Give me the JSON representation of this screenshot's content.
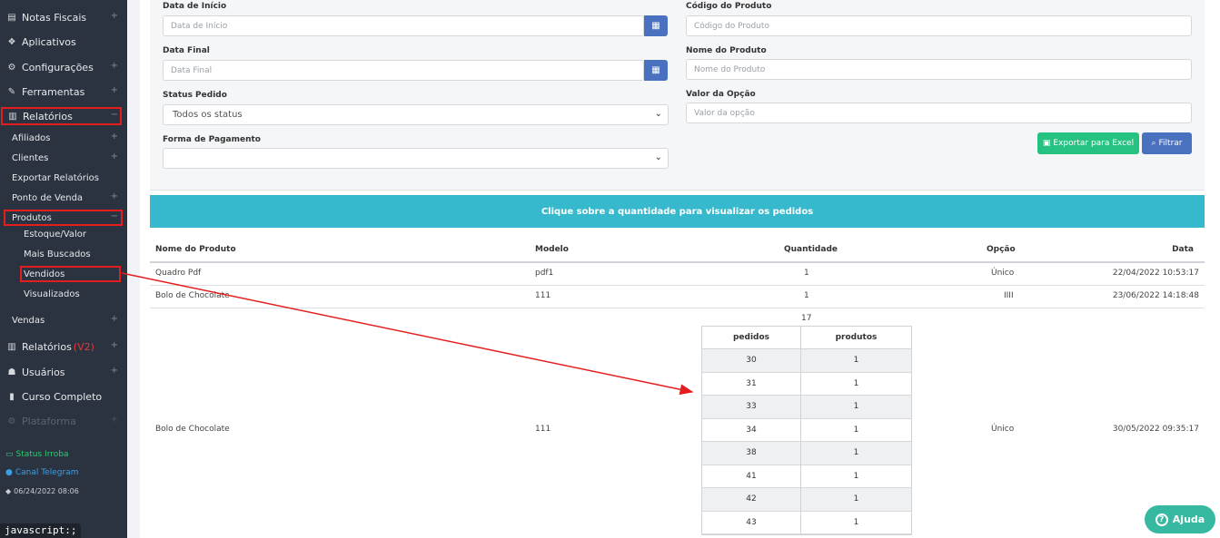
{
  "sidebar": {
    "items": [
      {
        "label": "Notas Fiscais",
        "icon": "receipt-icon",
        "glyph": "▤",
        "plus": "+"
      },
      {
        "label": "Aplicativos",
        "icon": "cubes-icon",
        "glyph": "❖",
        "plus": ""
      },
      {
        "label": "Configurações",
        "icon": "cogs-icon",
        "glyph": "⚙",
        "plus": "+"
      },
      {
        "label": "Ferramentas",
        "icon": "wrench-icon",
        "glyph": "✎",
        "plus": "+"
      },
      {
        "label": "Relatórios",
        "icon": "bar-chart-icon",
        "glyph": "▥",
        "plus": "−"
      }
    ],
    "sub": [
      {
        "label": "Afiliados",
        "plus": "+"
      },
      {
        "label": "Clientes",
        "plus": "+"
      },
      {
        "label": "Exportar Relatórios",
        "plus": ""
      },
      {
        "label": "Ponto de Venda",
        "plus": "+"
      },
      {
        "label": "Produtos",
        "plus": "−"
      }
    ],
    "subsub": [
      {
        "label": "Estoque/Valor"
      },
      {
        "label": "Mais Buscados"
      },
      {
        "label": "Vendidos"
      },
      {
        "label": "Visualizados"
      }
    ],
    "vendas": {
      "label": "Vendas",
      "plus": "+"
    },
    "items2": [
      {
        "label": "Relatórios",
        "suffix": "(V2)",
        "icon": "bar-chart-icon",
        "glyph": "▥",
        "plus": "+"
      },
      {
        "label": "Usuários",
        "icon": "users-icon",
        "glyph": "☗",
        "plus": "+"
      },
      {
        "label": "Curso Completo",
        "icon": "book-icon",
        "glyph": "▮",
        "plus": ""
      },
      {
        "label": "Plataforma",
        "icon": "cogs-icon",
        "glyph": "⚙",
        "plus": "+"
      }
    ],
    "footer": {
      "status": "Status Irroba",
      "telegram": "Canal Telegram",
      "timestamp": "06/24/2022 08:06"
    }
  },
  "statusbar": "javascript:;",
  "filters": {
    "start_date": {
      "label": "Data de Início",
      "placeholder": "Data de Início"
    },
    "end_date": {
      "label": "Data Final",
      "placeholder": "Data Final"
    },
    "status": {
      "label": "Status Pedido",
      "value": "Todos os status"
    },
    "payment": {
      "label": "Forma de Pagamento",
      "value": ""
    },
    "product_code": {
      "label": "Código do Produto",
      "placeholder": "Código do Produto"
    },
    "product_name": {
      "label": "Nome do Produto",
      "placeholder": "Nome do Produto"
    },
    "option_value": {
      "label": "Valor da Opção",
      "placeholder": "Valor da opção"
    },
    "export_label": "Exportar para Excel",
    "filter_label": "Filtrar"
  },
  "banner": "Clique sobre a quantidade para visualizar os pedidos",
  "table": {
    "headers": [
      "Nome do Produto",
      "Modelo",
      "Quantidade",
      "Opção",
      "Data"
    ],
    "rows": [
      {
        "name": "Quadro Pdf",
        "model": "pdf1",
        "qty": "1",
        "option": "Único",
        "date": "22/04/2022 10:53:17"
      },
      {
        "name": "Bolo de Chocolate",
        "model": "111",
        "qty": "1",
        "option": "IIII",
        "date": "23/06/2022 14:18:48"
      },
      {
        "name": "Bolo de Chocolate",
        "model": "111",
        "qty": "17",
        "option": "Único",
        "date": "30/05/2022 09:35:17"
      }
    ]
  },
  "orders": {
    "headers": [
      "pedidos",
      "produtos"
    ],
    "rows": [
      [
        "30",
        "1"
      ],
      [
        "31",
        "1"
      ],
      [
        "33",
        "1"
      ],
      [
        "34",
        "1"
      ],
      [
        "38",
        "1"
      ],
      [
        "41",
        "1"
      ],
      [
        "42",
        "1"
      ],
      [
        "43",
        "1"
      ]
    ]
  },
  "help": "Ajuda",
  "colors": {
    "sidebar": "#2b3340",
    "banner": "#36b9cc",
    "highlight": "#e41e1e",
    "export": "#26c281",
    "filter": "#4a70c0",
    "help": "#36b9a0"
  }
}
